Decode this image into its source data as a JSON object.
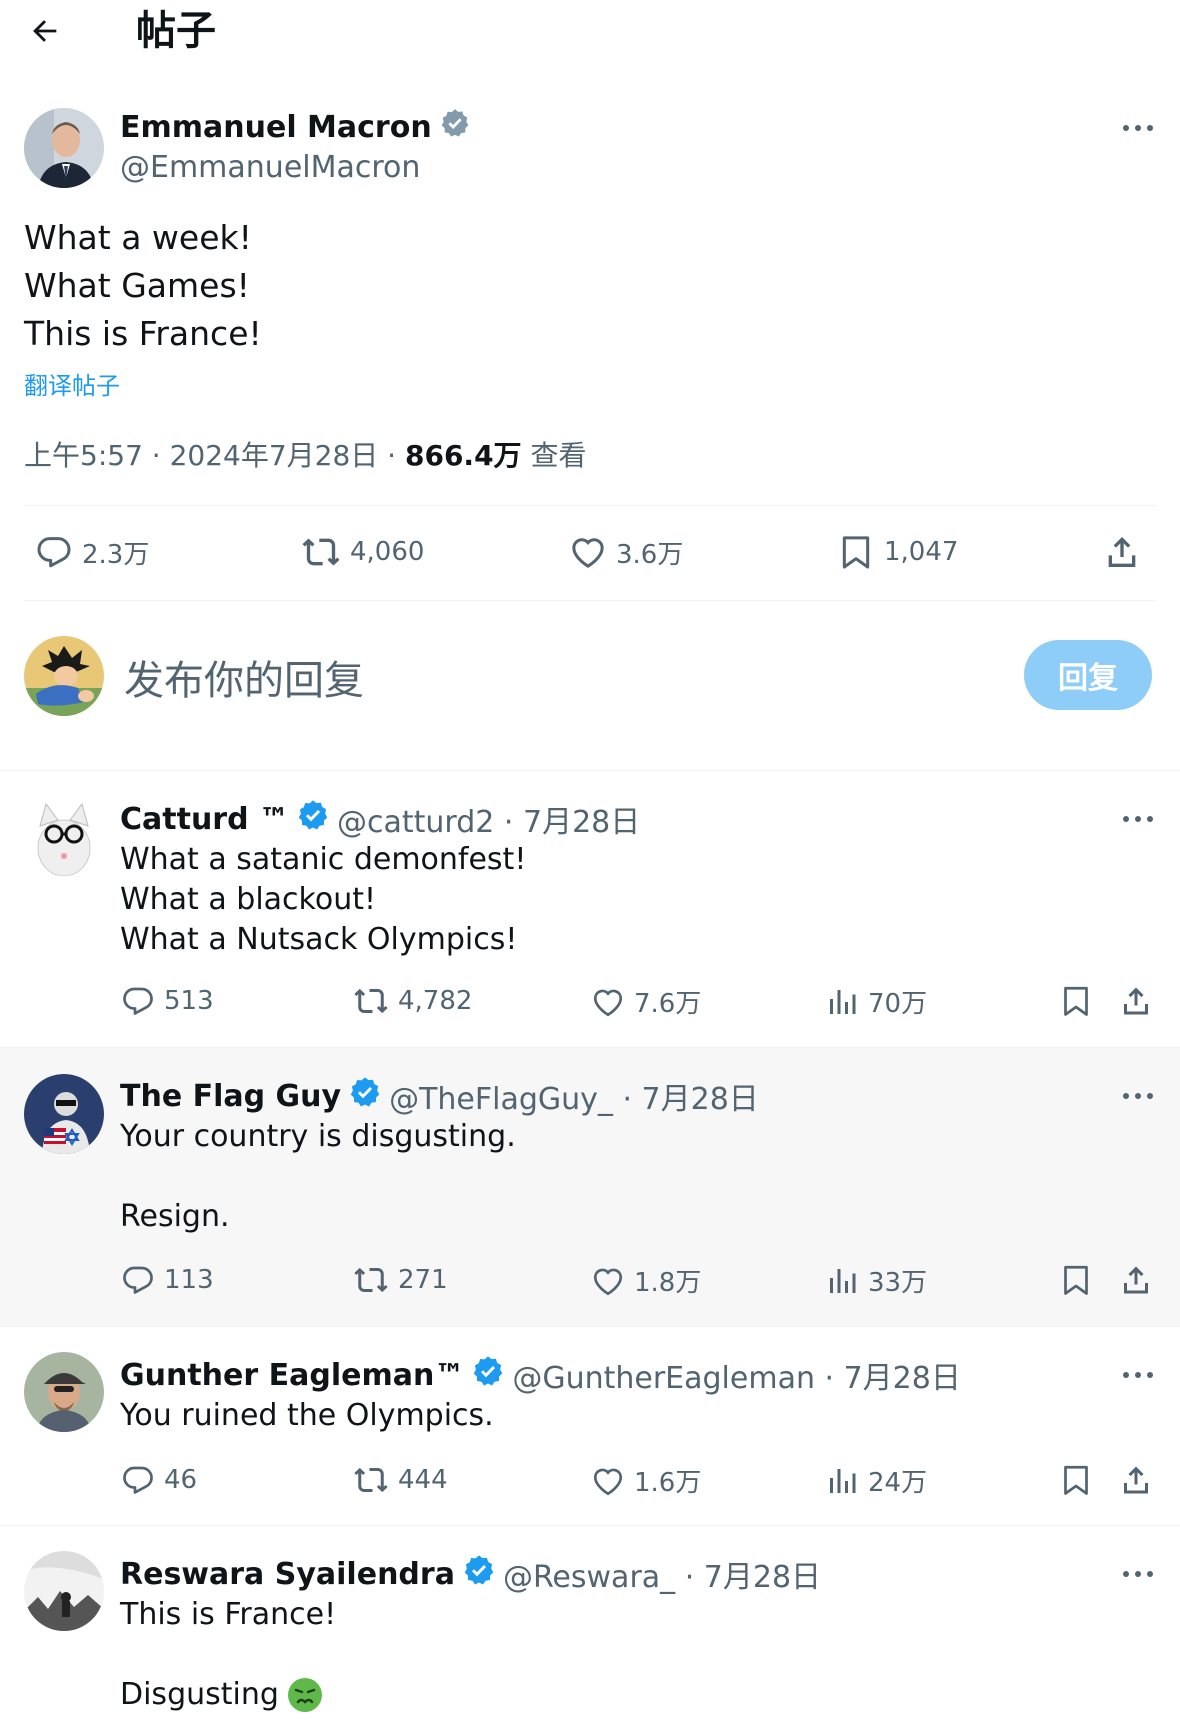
{
  "header": {
    "title": "帖子"
  },
  "post": {
    "author_name": "Emmanuel Macron",
    "author_handle": "@EmmanuelMacron",
    "lines": [
      "What a week!",
      "What Games!",
      "This is France!"
    ],
    "translate_label": "翻译帖子",
    "time": "上午5:57 · 2024年7月28日 · ",
    "views": "866.4万",
    "views_label": " 查看",
    "stats": {
      "replies": "2.3万",
      "reposts": "4,060",
      "likes": "3.6万",
      "bookmarks": "1,047"
    }
  },
  "composer": {
    "placeholder": "发布你的回复",
    "reply_button": "回复"
  },
  "replies": [
    {
      "name": "Catturd ™",
      "handle": "@catturd2 · 7月28日",
      "lines": [
        "What a satanic demonfest!",
        "What a blackout!",
        "What a Nutsack Olympics!"
      ],
      "stats": {
        "replies": "513",
        "reposts": "4,782",
        "likes": "7.6万",
        "views": "70万"
      }
    },
    {
      "name": "The Flag Guy",
      "handle": "@TheFlagGuy_ · 7月28日",
      "lines": [
        "Your country is disgusting.",
        "",
        "Resign."
      ],
      "stats": {
        "replies": "113",
        "reposts": "271",
        "likes": "1.8万",
        "views": "33万"
      }
    },
    {
      "name": "Gunther Eagleman™",
      "handle": "@GuntherEagleman · 7月28日",
      "lines": [
        "You ruined the Olympics."
      ],
      "stats": {
        "replies": "46",
        "reposts": "444",
        "likes": "1.6万",
        "views": "24万"
      }
    },
    {
      "name": "Reswara Syailendra",
      "handle": "@Reswara_ · 7月28日",
      "lines": [
        "This is France!",
        "",
        "Disgusting"
      ],
      "stats": {}
    }
  ],
  "colors": {
    "accent": "#1d9bf0",
    "secondary_text": "#536471",
    "reply_button_bg": "#8ecdf8"
  },
  "icons": [
    "back-arrow-icon",
    "verified-badge-icon",
    "more-icon",
    "reply-icon",
    "repost-icon",
    "like-icon",
    "views-icon",
    "bookmark-icon",
    "share-icon",
    "nauseated-face-emoji-icon"
  ]
}
